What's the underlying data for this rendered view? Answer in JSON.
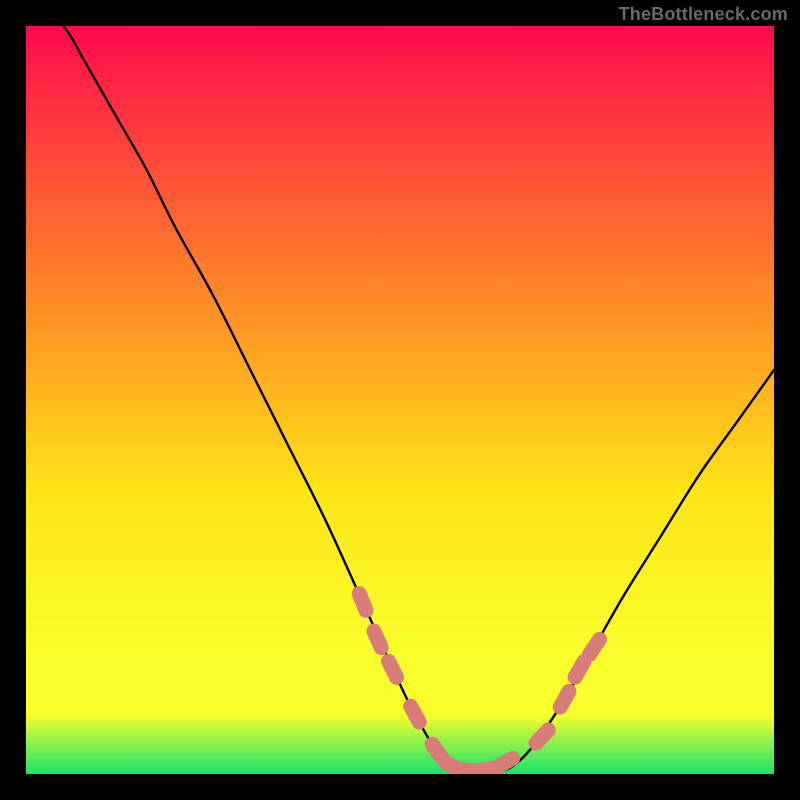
{
  "watermark": "TheBottleneck.com",
  "colors": {
    "frame": "#000000",
    "line": "#000000",
    "marker_fill": "#d87b79",
    "marker_stroke": "#d87b79",
    "gradient_top": "#ff0a4c",
    "gradient_mid1": "#ff8f25",
    "gradient_mid2": "#ffe418",
    "gradient_mid3": "#f8ff2b",
    "gradient_bottom": "#18e46e"
  },
  "chart_data": {
    "type": "line",
    "title": "",
    "xlabel": "",
    "ylabel": "",
    "xlim": [
      0,
      100
    ],
    "ylim": [
      0,
      100
    ],
    "grid": false,
    "legend": false,
    "x": [
      0,
      5,
      8,
      12,
      16,
      20,
      25,
      30,
      35,
      40,
      45,
      50,
      52,
      55,
      58,
      60,
      62,
      65,
      68,
      72,
      76,
      80,
      85,
      90,
      95,
      100
    ],
    "values": [
      105,
      100,
      95,
      88,
      81,
      73,
      64,
      54,
      44,
      34,
      23,
      12,
      8,
      3,
      1,
      0,
      0,
      1,
      4,
      10,
      17,
      24,
      32,
      40,
      47,
      54
    ],
    "highlighted_points": {
      "x": [
        45,
        47,
        49,
        52,
        55,
        57,
        59,
        61,
        64,
        69,
        72,
        74,
        76
      ],
      "values": [
        23,
        18,
        14,
        8,
        3,
        1,
        0.5,
        0.5,
        1.5,
        5,
        10,
        14,
        17
      ]
    }
  }
}
